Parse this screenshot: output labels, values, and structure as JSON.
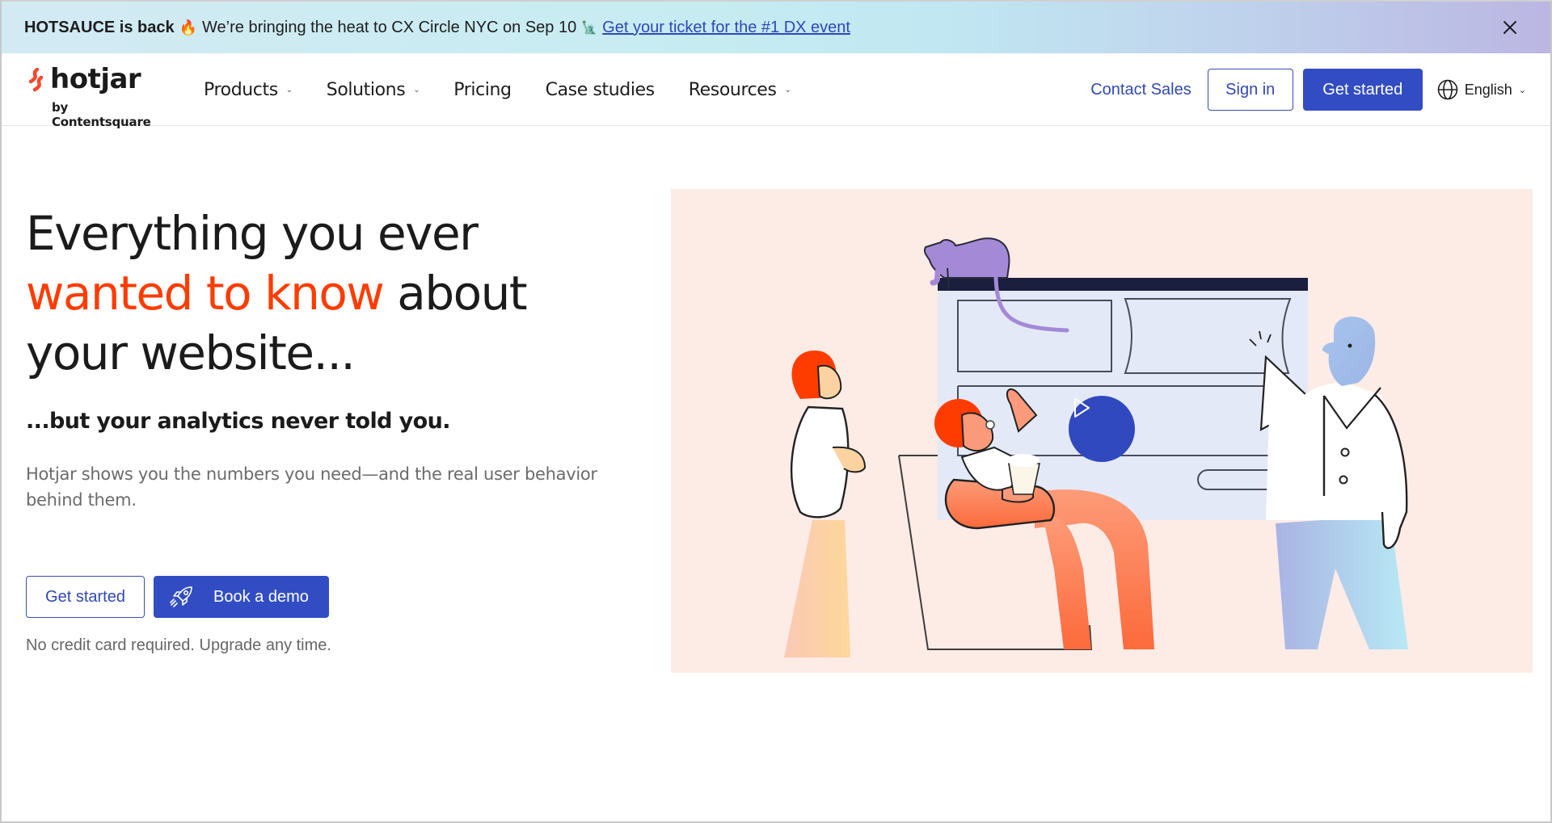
{
  "announcement": {
    "bold_text": "HOTSAUCE is back",
    "fire_emoji": "🔥",
    "message": "We’re bringing the heat to CX Circle NYC on Sep 10",
    "statue_emoji": "🗽",
    "link_text": "Get your ticket for the #1 DX event",
    "close_icon": "close-icon"
  },
  "nav": {
    "logo": {
      "wordmark": "hotjar",
      "byline": "by Contentsquare"
    },
    "menu": [
      {
        "label": "Products",
        "has_dropdown": true
      },
      {
        "label": "Solutions",
        "has_dropdown": true
      },
      {
        "label": "Pricing",
        "has_dropdown": false
      },
      {
        "label": "Case studies",
        "has_dropdown": false
      },
      {
        "label": "Resources",
        "has_dropdown": true
      }
    ],
    "contact_sales": "Contact Sales",
    "sign_in": "Sign in",
    "get_started": "Get started",
    "language": "English",
    "dropdown_chevron": "⌄"
  },
  "hero": {
    "headline_line1": "Everything you ever",
    "headline_accent": "wanted to know",
    "headline_after_accent": " about",
    "headline_line3": "your website...",
    "subhead": "...but your analytics never told you.",
    "body": "Hotjar shows you the numbers you need—and the real user behavior behind them.",
    "cta_primary": "Get started",
    "cta_secondary": "Book a demo",
    "note": "No credit card required. Upgrade any time."
  },
  "illustration": {
    "description": "Hero illustration of people watching a website mockup with a cat on top",
    "play_icon": "play-icon"
  },
  "colors": {
    "brand_blue": "#324dc3",
    "accent_orange": "#ff3c00",
    "illustration_bg": "#fdebe6"
  }
}
